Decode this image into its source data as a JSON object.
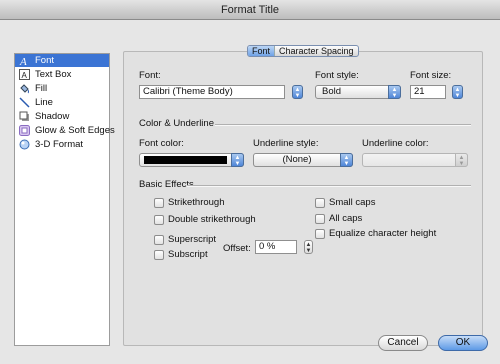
{
  "window": {
    "title": "Format Title"
  },
  "sidebar": {
    "items": [
      {
        "label": "Font",
        "icon": "font-icon"
      },
      {
        "label": "Text Box",
        "icon": "text-box-icon"
      },
      {
        "label": "Fill",
        "icon": "fill-bucket-icon"
      },
      {
        "label": "Line",
        "icon": "line-icon"
      },
      {
        "label": "Shadow",
        "icon": "shadow-icon"
      },
      {
        "label": "Glow & Soft Edges",
        "icon": "glow-icon"
      },
      {
        "label": "3-D Format",
        "icon": "3d-format-icon"
      }
    ]
  },
  "tabs": [
    {
      "label": "Font"
    },
    {
      "label": "Character Spacing"
    }
  ],
  "font": {
    "font_label": "Font:",
    "font_value": "Calibri (Theme Body)",
    "style_label": "Font style:",
    "style_value": "Bold",
    "size_label": "Font size:",
    "size_value": "21"
  },
  "color_underline": {
    "section_label": "Color & Underline",
    "font_color_label": "Font color:",
    "font_color_value": "#000000",
    "underline_style_label": "Underline style:",
    "underline_style_value": "(None)",
    "underline_color_label": "Underline color:"
  },
  "effects": {
    "section_label": "Basic Effects",
    "strikethrough": "Strikethrough",
    "double_strikethrough": "Double strikethrough",
    "superscript": "Superscript",
    "subscript": "Subscript",
    "offset_label": "Offset:",
    "offset_value": "0 %",
    "small_caps": "Small caps",
    "all_caps": "All caps",
    "equalize": "Equalize character height"
  },
  "buttons": {
    "cancel": "Cancel",
    "ok": "OK"
  }
}
